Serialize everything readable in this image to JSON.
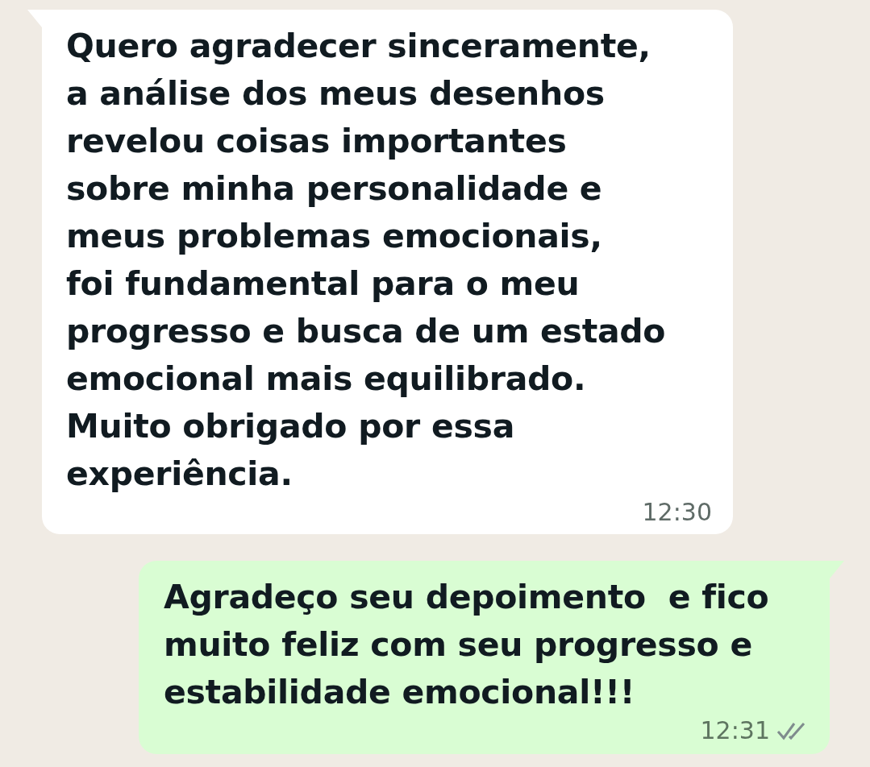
{
  "messages": [
    {
      "kind": "incoming",
      "text": "Quero agradecer sinceramente,\na análise dos meus desenhos\nrevelou coisas importantes\nsobre minha personalidade e\nmeus problemas emocionais,\nfoi fundamental para o meu\nprogresso e busca de um estado\nemocional mais equilibrado.\nMuito obrigado por essa\nexperiência.",
      "time": "12:30"
    },
    {
      "kind": "outgoing",
      "text": "Agradeço seu depoimento  e fico\nmuito feliz com seu progresso e\nestabilidade emocional!!!",
      "time": "12:31",
      "read": false
    }
  ]
}
